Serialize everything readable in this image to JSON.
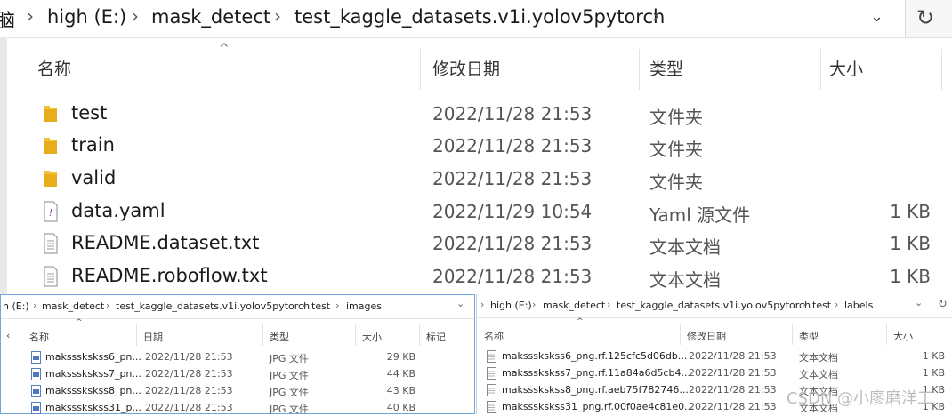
{
  "main": {
    "address": {
      "crumbs": [
        "脑",
        "high (E:)",
        "mask_detect",
        "test_kaggle_datasets.v1i.yolov5pytorch"
      ],
      "separator": "›",
      "dropdown_glyph": "⌄",
      "refresh_glyph": "↻"
    },
    "columns": {
      "name": "名称",
      "date": "修改日期",
      "type": "类型",
      "size": "大小"
    },
    "sort_caret": "^",
    "rows": [
      {
        "name": "test",
        "date": "2022/11/28 21:53",
        "type": "文件夹",
        "size": "",
        "icon": "folder-icon"
      },
      {
        "name": "train",
        "date": "2022/11/28 21:53",
        "type": "文件夹",
        "size": "",
        "icon": "folder-icon"
      },
      {
        "name": "valid",
        "date": "2022/11/28 21:53",
        "type": "文件夹",
        "size": "",
        "icon": "folder-icon"
      },
      {
        "name": "data.yaml",
        "date": "2022/11/29 10:54",
        "type": "Yaml 源文件",
        "size": "1 KB",
        "icon": "yaml-file-icon"
      },
      {
        "name": "README.dataset.txt",
        "date": "2022/11/28 21:53",
        "type": "文本文档",
        "size": "1 KB",
        "icon": "text-file-icon"
      },
      {
        "name": "README.roboflow.txt",
        "date": "2022/11/28 21:53",
        "type": "文本文档",
        "size": "1 KB",
        "icon": "text-file-icon"
      }
    ]
  },
  "left_window": {
    "crumbs": [
      "h (E:)",
      "mask_detect",
      "test_kaggle_datasets.v1i.yolov5pytorch",
      "test",
      "images"
    ],
    "separator": "›",
    "dropdown_glyph": "⌄",
    "columns": {
      "name": "名称",
      "date": "日期",
      "type": "类型",
      "size": "大小",
      "tag": "标记"
    },
    "sort_caret": "^",
    "rows": [
      {
        "name": "makssskskss6_pn...",
        "date": "2022/11/28 21:53",
        "type": "JPG 文件",
        "size": "29 KB"
      },
      {
        "name": "makssskskss7_pn...",
        "date": "2022/11/28 21:53",
        "type": "JPG 文件",
        "size": "44 KB"
      },
      {
        "name": "makssskskss8_pn...",
        "date": "2022/11/28 21:53",
        "type": "JPG 文件",
        "size": "43 KB"
      },
      {
        "name": "makssskskss31_p...",
        "date": "2022/11/28 21:53",
        "type": "JPG 文件",
        "size": "40 KB"
      }
    ]
  },
  "right_window": {
    "crumbs": [
      "high (E:)",
      "mask_detect",
      "test_kaggle_datasets.v1i.yolov5pytorch",
      "test",
      "labels"
    ],
    "separator": "›",
    "dropdown_glyph": "⌄",
    "refresh_glyph": "↻",
    "columns": {
      "name": "名称",
      "date": "修改日期",
      "type": "类型",
      "size": "大小"
    },
    "sort_caret": "^",
    "rows": [
      {
        "name": "makssskskss6_png.rf.125cfc5d06db...",
        "date": "2022/11/28 21:53",
        "type": "文本文档",
        "size": "1 KB"
      },
      {
        "name": "makssskskss7_png.rf.11a84a6d5cb4...",
        "date": "2022/11/28 21:53",
        "type": "文本文档",
        "size": "1 KB"
      },
      {
        "name": "makssskskss8_png.rf.aeb75f782746...",
        "date": "2022/11/28 21:53",
        "type": "文本文档",
        "size": "1 KB"
      },
      {
        "name": "makssskskss31_png.rf.00f0ae4c81e0...",
        "date": "2022/11/28 21:53",
        "type": "文本文档",
        "size": "1 KB"
      }
    ]
  },
  "watermark": "CSDN @小廖磨洋工",
  "colors": {
    "folder": "#f3c13a",
    "selection_border": "#6fa8dc",
    "yaml_accent": "#7a3fb0"
  }
}
